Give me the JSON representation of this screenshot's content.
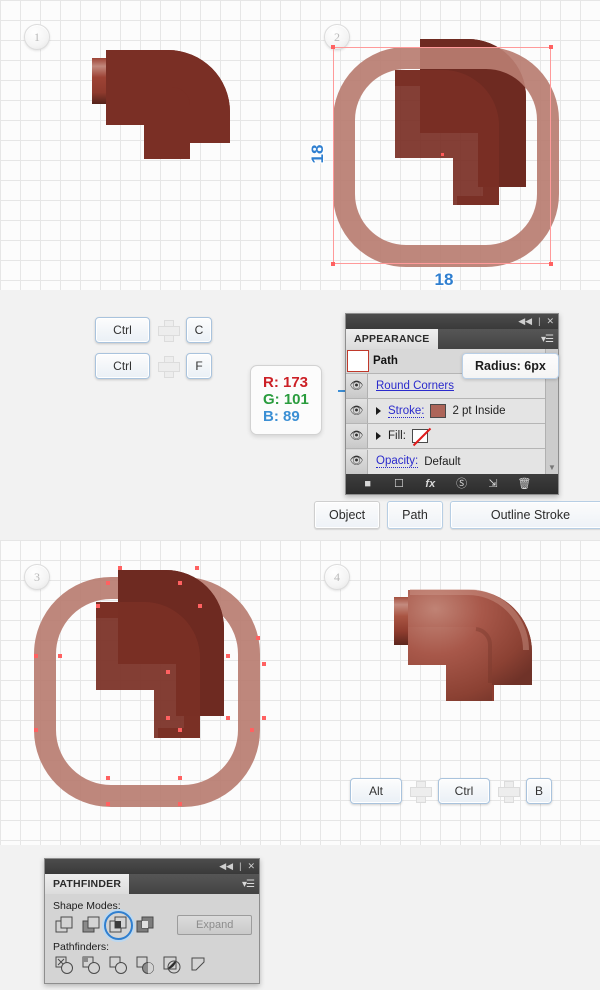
{
  "steps": [
    {
      "num": "1"
    },
    {
      "num": "2"
    },
    {
      "num": "3"
    },
    {
      "num": "4"
    }
  ],
  "dimensions": {
    "width_label": "18",
    "height_label": "18"
  },
  "shortcuts": {
    "row1": {
      "key1": "Ctrl",
      "plus": "+",
      "key2": "C"
    },
    "row2": {
      "key1": "Ctrl",
      "plus": "+",
      "key2": "F"
    },
    "row3": {
      "key1": "Alt",
      "plus1": "+",
      "key2": "Ctrl",
      "plus2": "+",
      "key3": "B"
    }
  },
  "menu_buttons": {
    "object": "Object",
    "path": "Path",
    "outline_stroke": "Outline Stroke"
  },
  "rgb_callout": {
    "r": "R: 173",
    "g": "G: 101",
    "b": "B: 89",
    "hex": "#ad6559"
  },
  "appearance_panel": {
    "titlebar": {
      "collapse_icon": "◀◀",
      "divider": "|",
      "close_icon": "✕"
    },
    "tab_label": "APPEARANCE",
    "menu_icon": "▾☰",
    "rows": [
      {
        "label": "Path",
        "type": "header"
      },
      {
        "label": "Round Corners",
        "type": "effect"
      },
      {
        "label": "Stroke:",
        "value": "2 pt  Inside",
        "type": "stroke",
        "swatch": "#ad6559"
      },
      {
        "label": "Fill:",
        "value": "",
        "type": "fill",
        "swatch": "none"
      },
      {
        "label": "Opacity:",
        "value": "Default",
        "type": "opacity"
      }
    ],
    "tooltip": "Radius: 6px",
    "footer_icons": [
      "add-new-stroke",
      "add-new-fill",
      "add-effect",
      "clear-appearance",
      "duplicate-item",
      "delete-item"
    ]
  },
  "pathfinder_panel": {
    "titlebar": {
      "collapse_icon": "◀◀",
      "divider": "|",
      "close_icon": "✕"
    },
    "tab_label": "PATHFINDER",
    "menu_icon": "▾☰",
    "shape_modes_label": "Shape Modes:",
    "pathfinders_label": "Pathfinders:",
    "expand_label": "Expand",
    "shape_modes": [
      "unite",
      "minus-front",
      "intersect",
      "exclude"
    ],
    "selected_shape_mode": 2,
    "pathfinders": [
      "divide",
      "trim",
      "merge",
      "crop",
      "outline",
      "minus-back"
    ]
  },
  "colors": {
    "pipe_dark": "#7a2f25",
    "pipe_mid": "#a04a3a",
    "pipe_light": "#c9897c",
    "stroke_outline": "#ad6559",
    "accent_blue": "#2f7fd0",
    "selection_red": "#ff6161"
  }
}
